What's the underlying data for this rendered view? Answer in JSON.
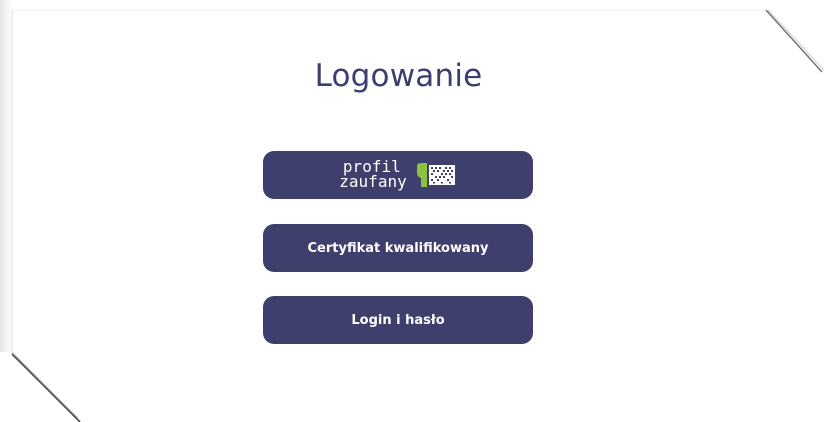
{
  "page": {
    "title": "Logowanie"
  },
  "buttons": {
    "profil_zaufany": {
      "line1": "profil",
      "line2": "zaufany",
      "icon": "profil-zaufany-logo-icon",
      "bg_color": "#3f3f6e",
      "accent_green": "#8ac43f"
    },
    "certyfikat": {
      "label": "Certyfikat kwalifikowany"
    },
    "login_haslo": {
      "label": "Login i hasło"
    }
  },
  "colors": {
    "title": "#3b3e6e",
    "button_bg": "#3f3f6e",
    "button_text": "#ffffff",
    "card_border": "#7a7a7a"
  }
}
